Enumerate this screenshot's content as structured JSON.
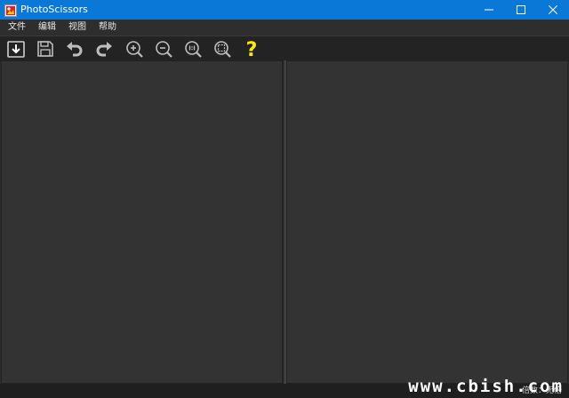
{
  "window": {
    "title": "PhotoScissors",
    "controls": [
      "minimize-icon",
      "maximize-icon",
      "close-icon"
    ]
  },
  "menu": {
    "items": [
      "文件",
      "编辑",
      "视图",
      "帮助"
    ]
  },
  "toolbar": {
    "tools": [
      "import-image-icon",
      "save-icon",
      "undo-icon",
      "redo-icon",
      "zoom-in-icon",
      "zoom-out-icon",
      "actual-size-icon",
      "fit-to-window-icon",
      "help-icon"
    ],
    "help_label": "?"
  },
  "status": {
    "text": "倍数：无倍",
    "watermark": "www.cbish.com"
  },
  "colors": {
    "titlebar": "#0a78d7",
    "help_accent": "#f7e81a",
    "canvas": "#333333"
  }
}
